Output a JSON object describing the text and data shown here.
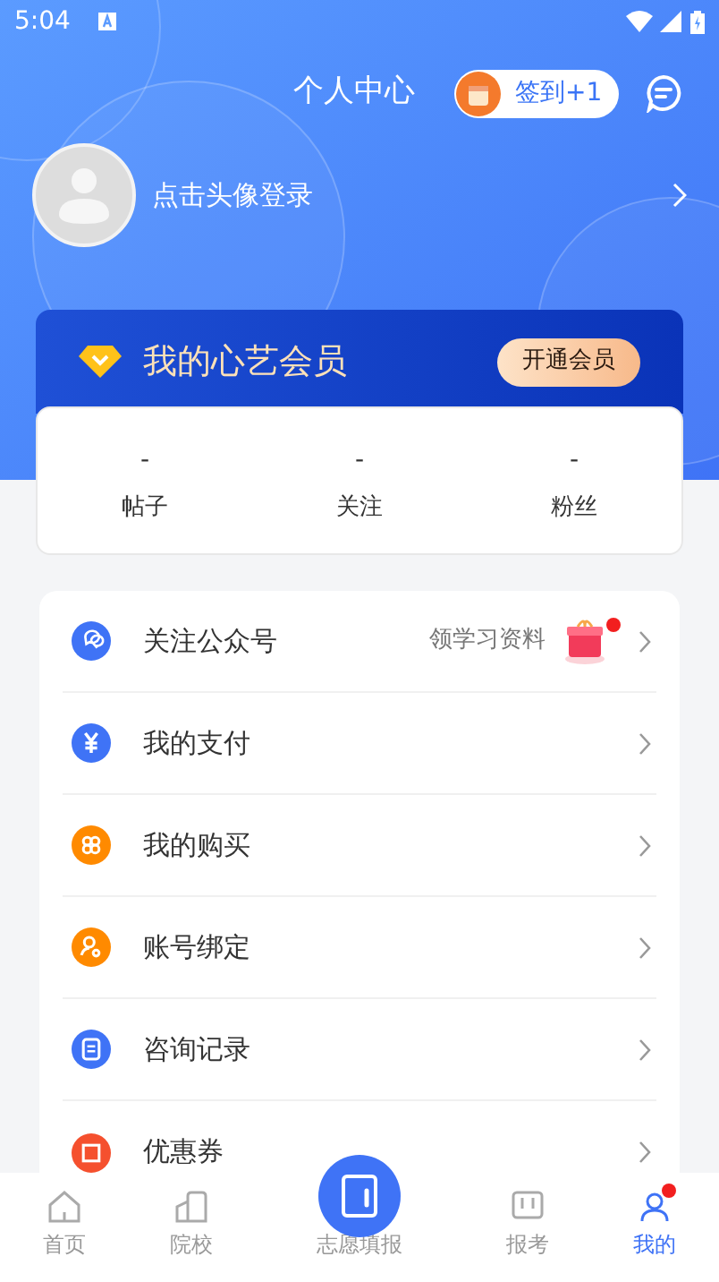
{
  "status_bar": {
    "time": "5:04"
  },
  "header": {
    "title": "个人中心",
    "checkin": "签到+1"
  },
  "profile": {
    "login_prompt": "点击头像登录"
  },
  "membership": {
    "title": "我的心艺会员",
    "button": "开通会员",
    "stats": [
      {
        "value": "-",
        "label": "帖子"
      },
      {
        "value": "-",
        "label": "关注"
      },
      {
        "value": "-",
        "label": "粉丝"
      }
    ]
  },
  "menu": [
    {
      "label": "关注公众号",
      "hint": "领学习资料",
      "dot": true
    },
    {
      "label": "我的支付"
    },
    {
      "label": "我的购买"
    },
    {
      "label": "账号绑定"
    },
    {
      "label": "咨询记录"
    },
    {
      "label": "优惠券"
    }
  ],
  "tab_bar": [
    {
      "label": "首页",
      "selected": false,
      "dot": false
    },
    {
      "label": "院校",
      "selected": false,
      "dot": false
    },
    {
      "label": "志愿填报",
      "selected": false,
      "dot": false
    },
    {
      "label": "报考",
      "selected": false,
      "dot": false
    },
    {
      "label": "我的",
      "selected": true,
      "dot": true
    }
  ]
}
